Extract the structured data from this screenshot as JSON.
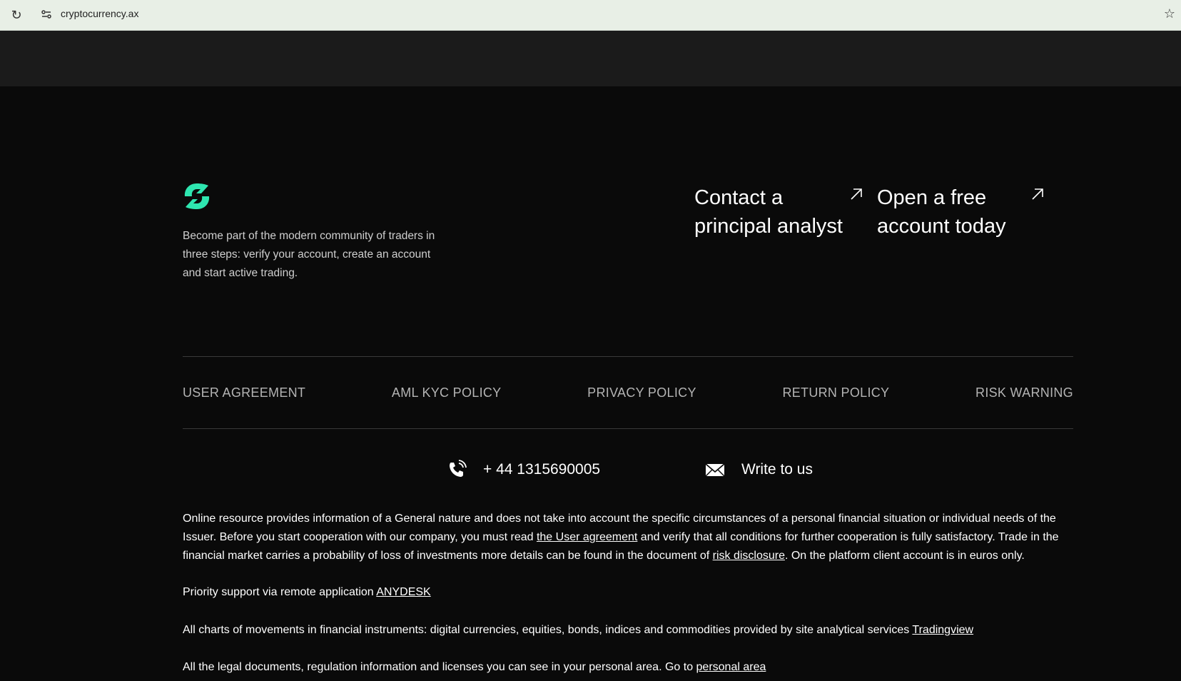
{
  "browser": {
    "url": "cryptocurrency.ax",
    "reload_icon": "reload-icon",
    "site_info_icon": "site-info-icon",
    "bookmark_icon": "star-icon"
  },
  "footer": {
    "logo_icon": "brand-logo",
    "brand_color": "#2ee6b0",
    "about": "Become part of the modern community of traders in three steps: verify your account, create an account and start active trading.",
    "cta_contact": "Contact a principal analyst",
    "cta_open": "Open a free account today",
    "cta_arrow_icon": "arrow-up-right-icon",
    "nav": [
      {
        "label": "USER AGREEMENT"
      },
      {
        "label": "AML KYC POLICY"
      },
      {
        "label": "PRIVACY POLICY"
      },
      {
        "label": "RETURN POLICY"
      },
      {
        "label": "RISK WARNING"
      }
    ],
    "phone": "+ 44 1315690005",
    "phone_icon": "phone-icon",
    "write_us": "Write to us",
    "mail_icon": "envelope-icon",
    "legal": {
      "p1_part1": "Online resource provides information of a General nature and does not take into account the specific circumstances of a personal financial situation or individual needs of the Issuer. Before you start cooperation with our company, you must read ",
      "p1_link1": "the User agreement",
      "p1_part2": " and verify that all conditions for further cooperation is fully satisfactory. Trade in the financial market carries a probability of loss of investments more details can be found in the document of ",
      "p1_link2": "risk disclosure",
      "p1_part3": ". On the platform client account is in euros only.",
      "p2_text": "Priority support via remote application ",
      "p2_link": "ANYDESK",
      "p3_text": "All charts of movements in financial instruments: digital currencies, equities, bonds, indices and commodities provided by site analytical services ",
      "p3_link": "Tradingview",
      "p4_text": "All the legal documents, regulation information and licenses you can see in your personal area. Go to ",
      "p4_link": "personal area"
    }
  }
}
